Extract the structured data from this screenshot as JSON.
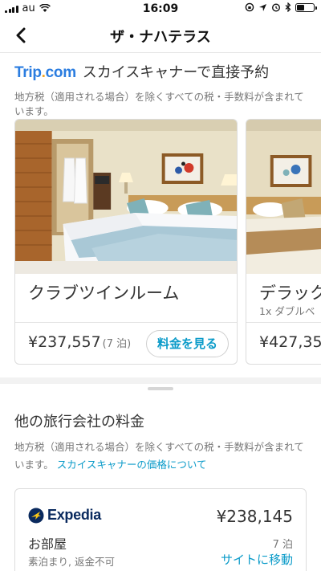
{
  "status_bar": {
    "carrier": "au",
    "time": "16:09"
  },
  "nav": {
    "title": "ザ・ナハテラス"
  },
  "direct_booking": {
    "partner_logo_text": "Trip",
    "partner_logo_dot": ".",
    "partner_logo_suffix": "com",
    "title": "スカイスキャナーで直接予約",
    "tax_note": "地方税（適用される場合）を除くすべての税・手数料が含まれています。"
  },
  "rooms": [
    {
      "name": "クラブツインルーム",
      "sub": "",
      "price": "¥237,557",
      "nights": "(7 泊)",
      "button_label": "料金を見る"
    },
    {
      "name": "デラック",
      "sub": "1x ダブルベ",
      "price": "¥427,35",
      "nights": "",
      "button_label": ""
    }
  ],
  "other_agents": {
    "title": "他の旅行会社の料金",
    "note": "地方税（適用される場合）を除くすべての税・手数料が含まれています。",
    "link": "スカイスキャナーの価格について",
    "offers": [
      {
        "agent_name": "Expedia",
        "price": "¥238,145",
        "room": "お部屋",
        "nights": "7 泊",
        "terms": "素泊まり, 返金不可",
        "link": "サイトに移動"
      }
    ]
  },
  "colors": {
    "accent": "#0b9bc9",
    "trip_blue": "#2b7de0",
    "expedia_navy": "#0a2a5e",
    "expedia_yellow": "#f7c518"
  },
  "icons": {
    "back": "chevron-left-icon",
    "wifi": "wifi-icon",
    "location": "location-arrow-icon",
    "alarm": "alarm-icon",
    "bluetooth": "bluetooth-icon",
    "battery": "battery-icon",
    "expedia": "globe-plane-icon"
  }
}
